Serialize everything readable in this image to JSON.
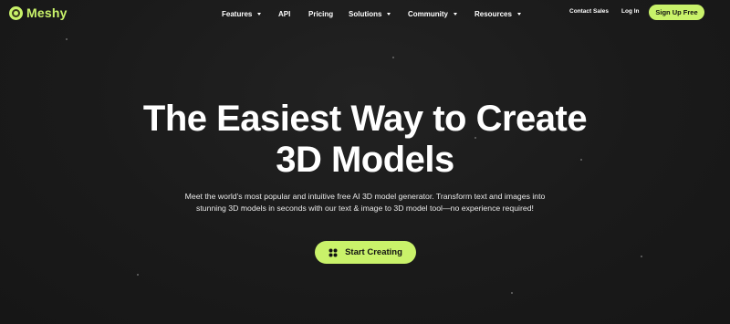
{
  "brand": {
    "name": "Meshy",
    "accent_color": "#c9f26a",
    "background_color": "#191919"
  },
  "nav": {
    "items": [
      {
        "label": "Features",
        "has_dropdown": true
      },
      {
        "label": "API",
        "has_dropdown": false
      },
      {
        "label": "Pricing",
        "has_dropdown": false
      },
      {
        "label": "Solutions",
        "has_dropdown": true
      },
      {
        "label": "Community",
        "has_dropdown": true
      },
      {
        "label": "Resources",
        "has_dropdown": true
      }
    ],
    "contact_sales": "Contact Sales",
    "login": "Log In",
    "signup": "Sign Up Free"
  },
  "hero": {
    "title_line1": "The Easiest Way to Create",
    "title_line2": "3D Models",
    "subtitle_line1": "Meet the world's most popular and intuitive free AI 3D model generator. Transform text and images into",
    "subtitle_line2": "stunning 3D models in seconds with our text & image to 3D model tool—no experience required!",
    "cta_label": "Start Creating",
    "cta_icon": "four-dots-icon"
  }
}
